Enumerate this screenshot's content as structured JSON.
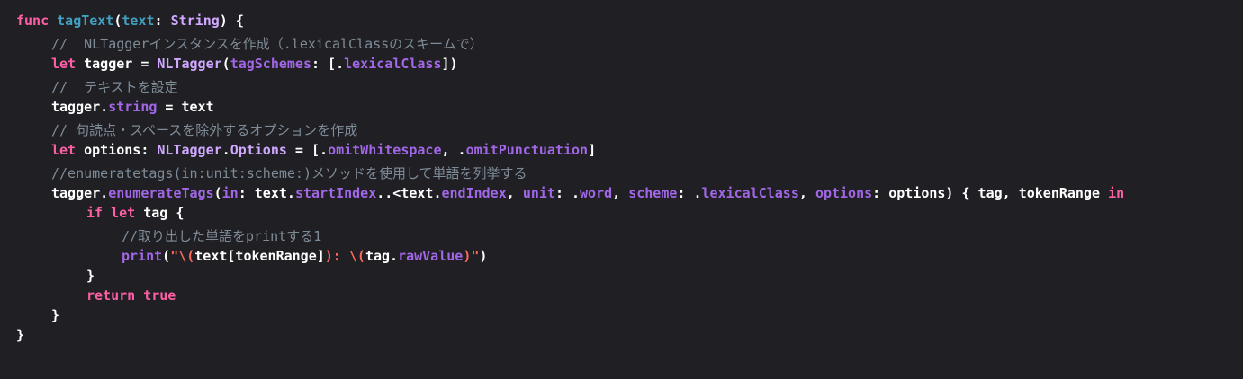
{
  "colors": {
    "background": "#1f1f24",
    "keyword": "#fc5fa3",
    "plain": "#ffffff",
    "type": "#d0a8ff",
    "method": "#a167e6",
    "declaration": "#41a1c0",
    "comment": "#7f8c98",
    "string": "#fc6a5d"
  },
  "lines": [
    {
      "indent": 0,
      "tokens": [
        {
          "t": "func",
          "c": "keyword"
        },
        {
          "t": " ",
          "c": "plain"
        },
        {
          "t": "tagText",
          "c": "declaration"
        },
        {
          "t": "(",
          "c": "plain"
        },
        {
          "t": "text",
          "c": "declaration"
        },
        {
          "t": ": ",
          "c": "plain"
        },
        {
          "t": "String",
          "c": "type"
        },
        {
          "t": ") {",
          "c": "plain"
        }
      ]
    },
    {
      "indent": 1,
      "gap": true,
      "comment": true,
      "tokens": [
        {
          "t": "//  NLTaggerインスタンスを作成（.lexicalClassのスキームで）",
          "c": "comment"
        }
      ]
    },
    {
      "indent": 1,
      "tokens": [
        {
          "t": "let",
          "c": "keyword"
        },
        {
          "t": " tagger = ",
          "c": "plain"
        },
        {
          "t": "NLTagger",
          "c": "type"
        },
        {
          "t": "(",
          "c": "plain"
        },
        {
          "t": "tagSchemes",
          "c": "method"
        },
        {
          "t": ": [.",
          "c": "plain"
        },
        {
          "t": "lexicalClass",
          "c": "method"
        },
        {
          "t": "])",
          "c": "plain"
        }
      ]
    },
    {
      "indent": 1,
      "gap": true,
      "comment": true,
      "tokens": [
        {
          "t": "//  テキストを設定",
          "c": "comment"
        }
      ]
    },
    {
      "indent": 1,
      "tokens": [
        {
          "t": "tagger.",
          "c": "plain"
        },
        {
          "t": "string",
          "c": "method"
        },
        {
          "t": " = text",
          "c": "plain"
        }
      ]
    },
    {
      "indent": 1,
      "gap": true,
      "comment": true,
      "tokens": [
        {
          "t": "// 句読点・スペースを除外するオプションを作成",
          "c": "comment"
        }
      ]
    },
    {
      "indent": 1,
      "tokens": [
        {
          "t": "let",
          "c": "keyword"
        },
        {
          "t": " options: ",
          "c": "plain"
        },
        {
          "t": "NLTagger",
          "c": "type"
        },
        {
          "t": ".",
          "c": "plain"
        },
        {
          "t": "Options",
          "c": "type"
        },
        {
          "t": " = [.",
          "c": "plain"
        },
        {
          "t": "omitWhitespace",
          "c": "method"
        },
        {
          "t": ", .",
          "c": "plain"
        },
        {
          "t": "omitPunctuation",
          "c": "method"
        },
        {
          "t": "]",
          "c": "plain"
        }
      ]
    },
    {
      "indent": 1,
      "gap": true,
      "comment": true,
      "tokens": [
        {
          "t": "//enumeratetags(in:unit:scheme:)メソッドを使用して単語を列挙する",
          "c": "comment"
        }
      ]
    },
    {
      "indent": 1,
      "tokens": [
        {
          "t": "tagger.",
          "c": "plain"
        },
        {
          "t": "enumerateTags",
          "c": "method"
        },
        {
          "t": "(",
          "c": "plain"
        },
        {
          "t": "in",
          "c": "method"
        },
        {
          "t": ": text.",
          "c": "plain"
        },
        {
          "t": "startIndex",
          "c": "method"
        },
        {
          "t": "..<text.",
          "c": "plain"
        },
        {
          "t": "endIndex",
          "c": "method"
        },
        {
          "t": ", ",
          "c": "plain"
        },
        {
          "t": "unit",
          "c": "method"
        },
        {
          "t": ": .",
          "c": "plain"
        },
        {
          "t": "word",
          "c": "method"
        },
        {
          "t": ", ",
          "c": "plain"
        },
        {
          "t": "scheme",
          "c": "method"
        },
        {
          "t": ": .",
          "c": "plain"
        },
        {
          "t": "lexicalClass",
          "c": "method"
        },
        {
          "t": ", ",
          "c": "plain"
        },
        {
          "t": "options",
          "c": "method"
        },
        {
          "t": ": options) { tag, tokenRange ",
          "c": "plain"
        },
        {
          "t": "in",
          "c": "keyword"
        }
      ]
    },
    {
      "indent": 2,
      "tokens": [
        {
          "t": "if",
          "c": "keyword"
        },
        {
          "t": " ",
          "c": "plain"
        },
        {
          "t": "let",
          "c": "keyword"
        },
        {
          "t": " tag {",
          "c": "plain"
        }
      ]
    },
    {
      "indent": 3,
      "gap": true,
      "comment": true,
      "tokens": [
        {
          "t": "//取り出した単語をprintする1",
          "c": "comment"
        }
      ]
    },
    {
      "indent": 3,
      "tokens": [
        {
          "t": "print",
          "c": "method"
        },
        {
          "t": "(",
          "c": "plain"
        },
        {
          "t": "\"\\(",
          "c": "string"
        },
        {
          "t": "text[tokenRange]",
          "c": "plain"
        },
        {
          "t": "): \\(",
          "c": "string"
        },
        {
          "t": "tag.",
          "c": "plain"
        },
        {
          "t": "rawValue",
          "c": "method"
        },
        {
          "t": ")\"",
          "c": "string"
        },
        {
          "t": ")",
          "c": "plain"
        }
      ]
    },
    {
      "indent": 2,
      "tokens": [
        {
          "t": "}",
          "c": "plain"
        }
      ]
    },
    {
      "indent": 2,
      "tokens": [
        {
          "t": "return",
          "c": "keyword"
        },
        {
          "t": " ",
          "c": "plain"
        },
        {
          "t": "true",
          "c": "keyword"
        }
      ]
    },
    {
      "indent": 1,
      "tokens": [
        {
          "t": "}",
          "c": "plain"
        }
      ]
    },
    {
      "indent": 0,
      "tokens": [
        {
          "t": "}",
          "c": "plain"
        }
      ]
    }
  ]
}
